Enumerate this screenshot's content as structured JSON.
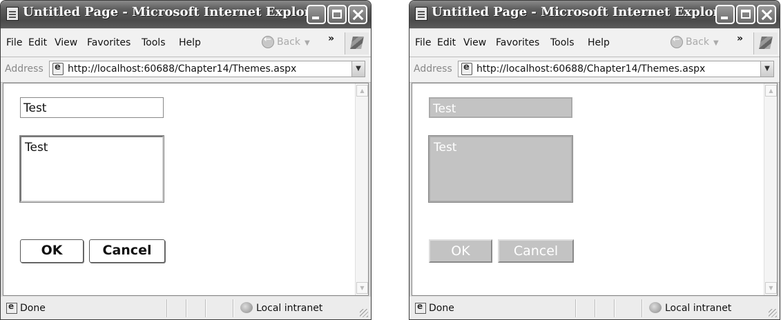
{
  "windows": [
    {
      "title": "Untitled Page - Microsoft Internet Explorer",
      "menu": [
        "File",
        "Edit",
        "View",
        "Favorites",
        "Tools",
        "Help"
      ],
      "toolbar": {
        "back_label": "Back",
        "chevron": "»"
      },
      "address": {
        "label": "Address",
        "url": "http://localhost:60688/Chapter14/Themes.aspx"
      },
      "form": {
        "textbox_value": "Test",
        "textarea_value": "Test",
        "ok_label": "OK",
        "cancel_label": "Cancel"
      },
      "status": {
        "text": "Done",
        "zone": "Local intranet"
      }
    },
    {
      "title": "Untitled Page - Microsoft Internet Explorer",
      "menu": [
        "File",
        "Edit",
        "View",
        "Favorites",
        "Tools",
        "Help"
      ],
      "toolbar": {
        "back_label": "Back",
        "chevron": "»"
      },
      "address": {
        "label": "Address",
        "url": "http://localhost:60688/Chapter14/Themes.aspx"
      },
      "form": {
        "textbox_value": "Test",
        "textarea_value": "Test",
        "ok_label": "OK",
        "cancel_label": "Cancel"
      },
      "status": {
        "text": "Done",
        "zone": "Local intranet"
      }
    }
  ],
  "icons": {
    "title_icon": "ie-page-icon",
    "minimize": "minimize-icon",
    "maximize": "maximize-icon",
    "close": "close-icon",
    "back": "back-arrow-icon",
    "logo": "windows-logo-icon",
    "address_page": "ie-page-icon",
    "zone": "local-intranet-icon"
  }
}
